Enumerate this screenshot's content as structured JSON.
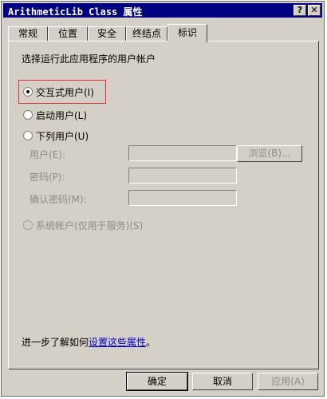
{
  "window": {
    "title": "ArithmeticLib Class 属性",
    "help_glyph": "?",
    "close_glyph": "✕"
  },
  "tabs": [
    {
      "label": "常规"
    },
    {
      "label": "位置"
    },
    {
      "label": "安全"
    },
    {
      "label": "终结点"
    },
    {
      "label": "标识",
      "active": true
    }
  ],
  "identity": {
    "heading": "选择运行此应用程序的用户帐户",
    "options": [
      {
        "label": "交互式用户(I)",
        "selected": true,
        "enabled": true
      },
      {
        "label": "启动用户(L)",
        "selected": false,
        "enabled": true
      },
      {
        "label": "下列用户(U)",
        "selected": false,
        "enabled": true
      },
      {
        "label": "系统帐户(仅用于服务)(S)",
        "selected": false,
        "enabled": false
      }
    ],
    "fields": {
      "user_label": "用户(E):",
      "password_label": "密码(P):",
      "confirm_label": "确认密码(M):",
      "user_value": "",
      "password_value": "",
      "confirm_value": ""
    },
    "browse_label": "浏览(B)..."
  },
  "footer": {
    "more_prefix": "进一步了解如何",
    "more_link": "设置这些属性",
    "more_suffix": "。"
  },
  "buttons": {
    "ok": "确定",
    "cancel": "取消",
    "apply": "应用(A)"
  },
  "colors": {
    "titlebar": "#000080",
    "face": "#d4d0c8",
    "focus_highlight": "#e03030",
    "link": "#0000cc"
  }
}
